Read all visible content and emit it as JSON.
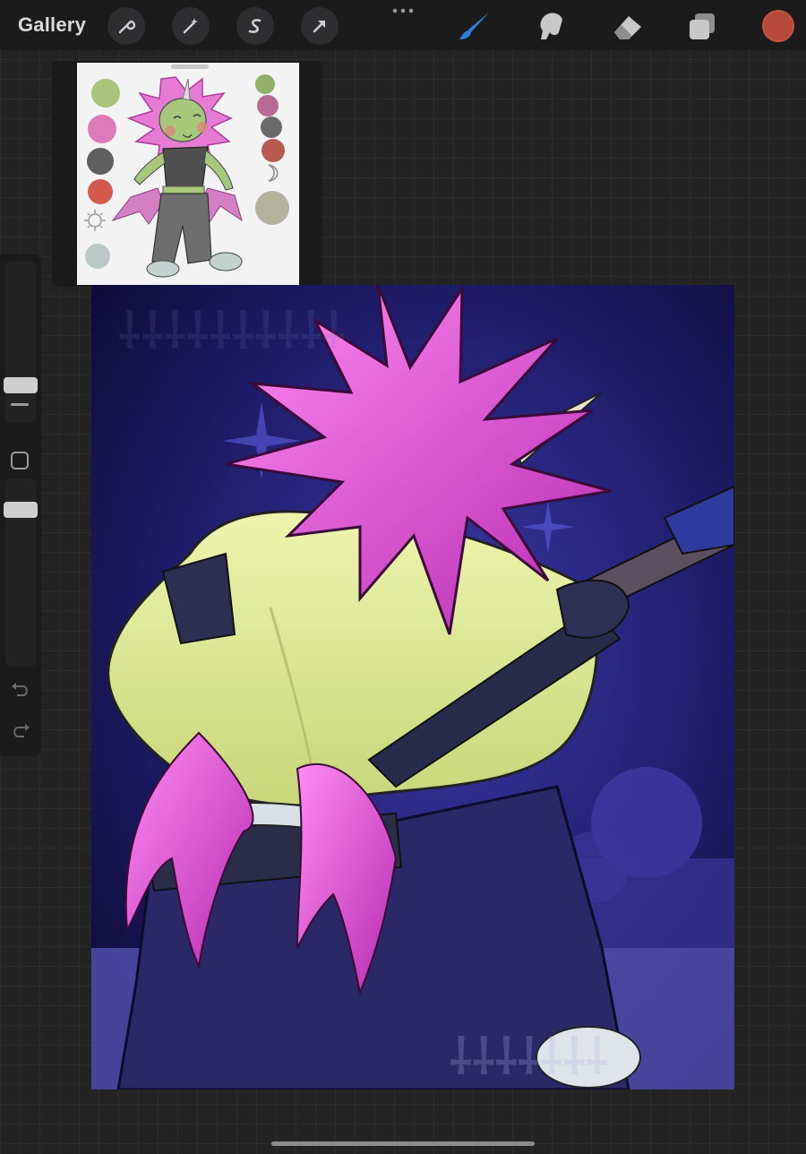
{
  "topbar": {
    "gallery_label": "Gallery",
    "left_tools": [
      "wrench-icon",
      "magic-wand-icon",
      "selection-s-icon",
      "transform-arrow-icon"
    ],
    "right_tools": [
      "brush-icon",
      "smudge-icon",
      "eraser-icon",
      "layers-icon"
    ],
    "active_tool": "brush-icon",
    "active_tool_color": "#2f7fe0",
    "current_color": "#b8493a"
  },
  "reference": {
    "palette_left": [
      "#a9c47c",
      "#de7ab8",
      "#5f5f5f",
      "#d45a4e",
      "#b9c7c5"
    ],
    "palette_right": [
      "#93b06a",
      "#b86a94",
      "#6a6a6a",
      "#b85a50",
      "#b3b39f"
    ]
  },
  "canvas": {
    "background": "#15124a",
    "accent_pink": "#e04cd6",
    "skin": "#e4ef9a",
    "pants": "#2b2868"
  }
}
